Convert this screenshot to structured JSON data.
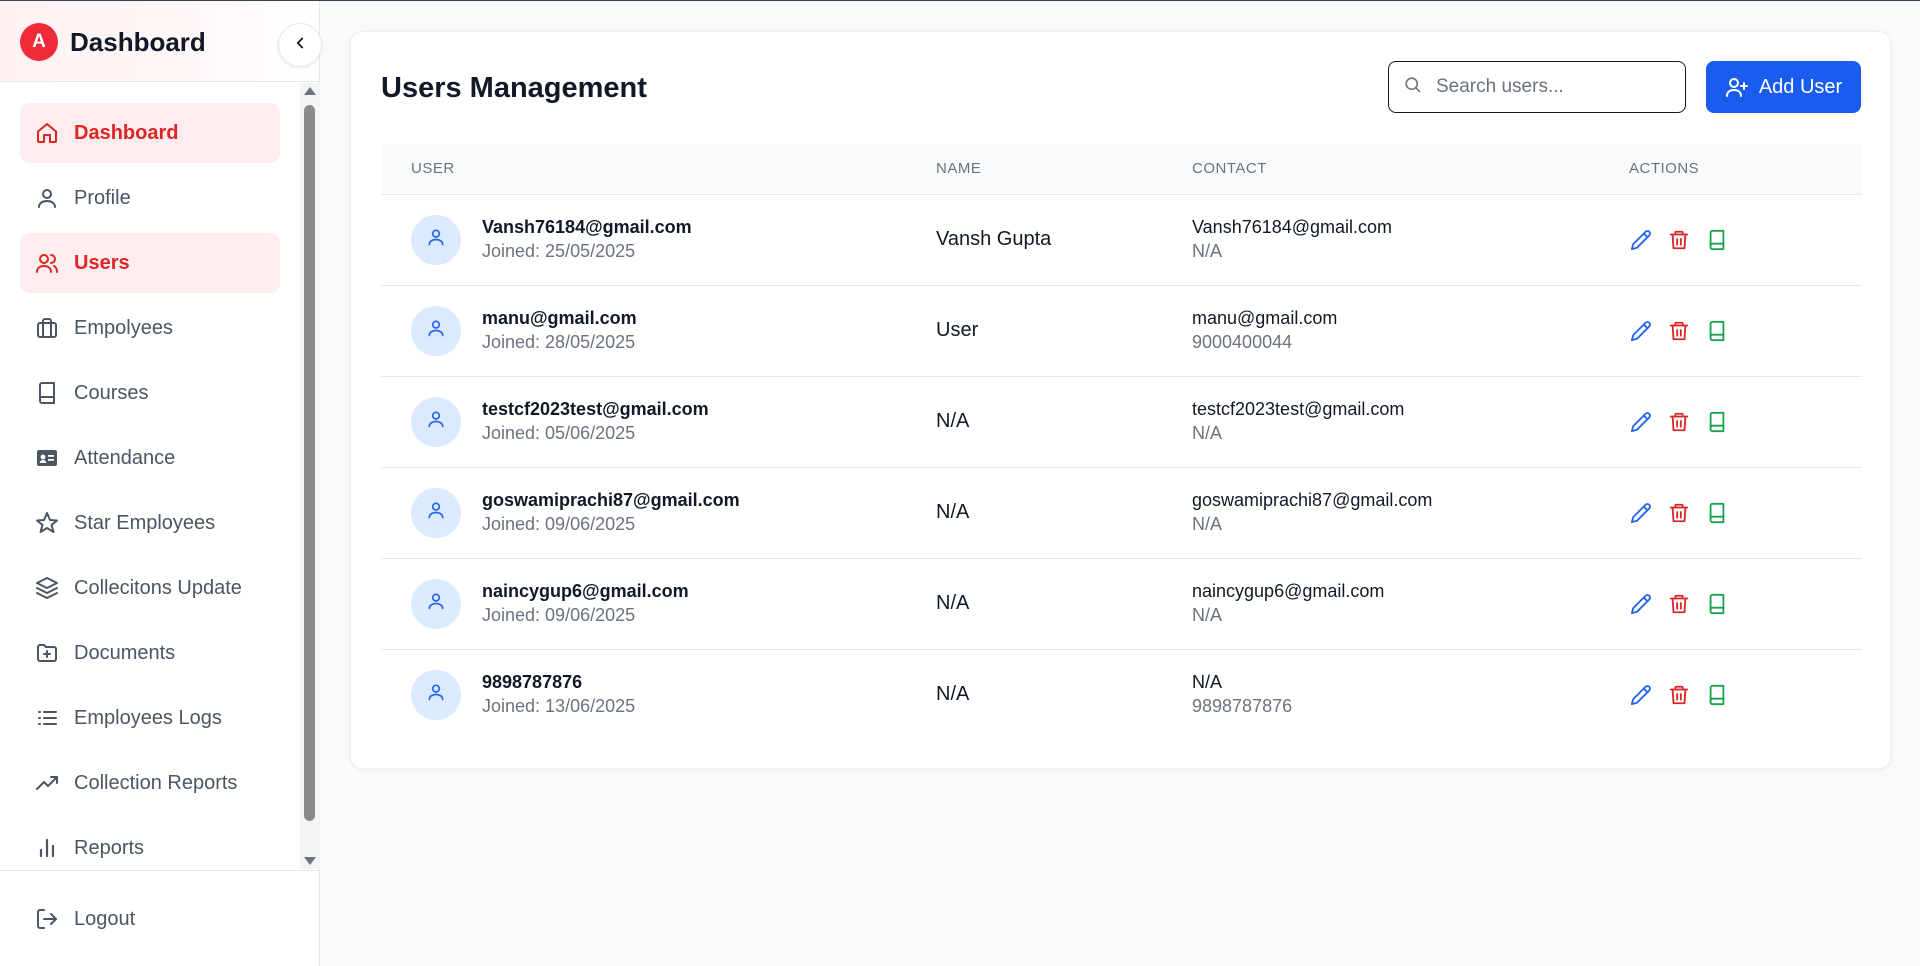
{
  "sidebar": {
    "logo_letter": "A",
    "brand": "Dashboard",
    "items": [
      {
        "label": "Dashboard",
        "icon": "home-icon",
        "active": true
      },
      {
        "label": "Profile",
        "icon": "user-icon",
        "active": false
      },
      {
        "label": "Users",
        "icon": "users-icon",
        "active": true
      },
      {
        "label": "Empolyees",
        "icon": "briefcase-icon",
        "active": false
      },
      {
        "label": "Courses",
        "icon": "book-icon",
        "active": false
      },
      {
        "label": "Attendance",
        "icon": "id-card-icon",
        "active": false
      },
      {
        "label": "Star Employees",
        "icon": "star-icon",
        "active": false
      },
      {
        "label": "Collecitons Update",
        "icon": "layers-icon",
        "active": false
      },
      {
        "label": "Documents",
        "icon": "folder-plus-icon",
        "active": false
      },
      {
        "label": "Employees Logs",
        "icon": "list-icon",
        "active": false
      },
      {
        "label": "Collection Reports",
        "icon": "trending-up-icon",
        "active": false
      },
      {
        "label": "Reports",
        "icon": "bar-chart-icon",
        "active": false
      }
    ],
    "logout_label": "Logout"
  },
  "main": {
    "title": "Users Management",
    "search_placeholder": "Search users...",
    "add_user_label": "Add User",
    "columns": [
      "USER",
      "NAME",
      "CONTACT",
      "ACTIONS"
    ],
    "rows": [
      {
        "email": "Vansh76184@gmail.com",
        "joined": "Joined: 25/05/2025",
        "name": "Vansh Gupta",
        "contact_email": "Vansh76184@gmail.com",
        "contact_phone": "N/A"
      },
      {
        "email": "manu@gmail.com",
        "joined": "Joined: 28/05/2025",
        "name": "User",
        "contact_email": "manu@gmail.com",
        "contact_phone": "9000400044"
      },
      {
        "email": "testcf2023test@gmail.com",
        "joined": "Joined: 05/06/2025",
        "name": "N/A",
        "contact_email": "testcf2023test@gmail.com",
        "contact_phone": "N/A"
      },
      {
        "email": "goswamiprachi87@gmail.com",
        "joined": "Joined: 09/06/2025",
        "name": "N/A",
        "contact_email": "goswamiprachi87@gmail.com",
        "contact_phone": "N/A"
      },
      {
        "email": "naincygup6@gmail.com",
        "joined": "Joined: 09/06/2025",
        "name": "N/A",
        "contact_email": "naincygup6@gmail.com",
        "contact_phone": "N/A"
      },
      {
        "email": "9898787876",
        "joined": "Joined: 13/06/2025",
        "name": "N/A",
        "contact_email": "N/A",
        "contact_phone": "9898787876"
      }
    ]
  },
  "colors": {
    "accent_red": "#dc2626",
    "primary_blue": "#1a5cf0",
    "edit_blue": "#2563eb",
    "delete_red": "#dc2626",
    "book_green": "#16a34a"
  }
}
